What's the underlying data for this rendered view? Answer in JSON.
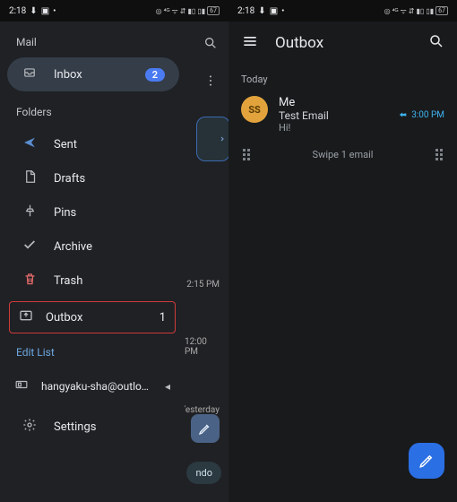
{
  "status": {
    "time": "2:18",
    "battery": "67"
  },
  "left": {
    "mailLabel": "Mail",
    "inbox": {
      "label": "Inbox",
      "badge": "2"
    },
    "foldersLabel": "Folders",
    "items": {
      "sent": "Sent",
      "drafts": "Drafts",
      "pins": "Pins",
      "archive": "Archive",
      "trash": "Trash"
    },
    "outbox": {
      "label": "Outbox",
      "count": "1"
    },
    "editList": "Edit List",
    "account": "hangyaku-sha@outlook…",
    "settings": "Settings",
    "bgTimes": {
      "t1": "2:15 PM",
      "t2": "12:00 PM",
      "yesterday": "Yesterday"
    },
    "undo": "ndo"
  },
  "right": {
    "title": "Outbox",
    "section": "Today",
    "msg": {
      "avatar": "SS",
      "from": "Me",
      "subject": "Test Email",
      "preview": "Hi!",
      "time": "3:00 PM"
    },
    "swipe": "Swipe 1 email"
  }
}
